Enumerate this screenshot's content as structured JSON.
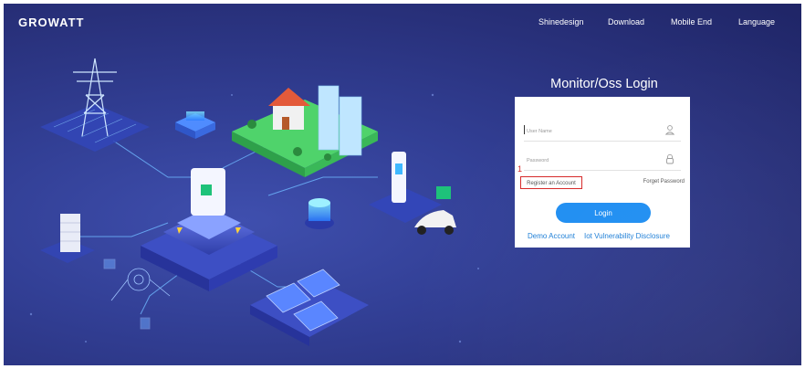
{
  "brand": {
    "name": "GROWATT"
  },
  "nav": {
    "items": [
      "Shinedesign",
      "Download",
      "Mobile End",
      "Language"
    ]
  },
  "login": {
    "title": "Monitor/Oss Login",
    "username_placeholder": "User Name",
    "password_placeholder": "Password",
    "register_label": "Register an Account",
    "register_marker": "1",
    "forget_label": "Forget Password",
    "login_button": "Login",
    "demo_label": "Demo Account",
    "iot_label": "Iot Vulnerability Disclosure"
  },
  "icons": [
    "user-icon",
    "lock-icon"
  ],
  "colors": {
    "accent": "#1f8ef2",
    "link": "#1b7dd6",
    "highlight": "#d62828",
    "background": "#2d3a8f"
  }
}
